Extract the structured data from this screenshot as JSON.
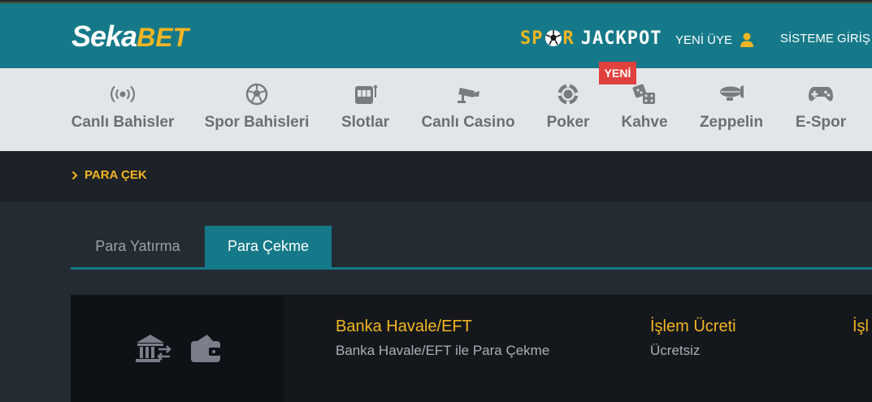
{
  "header": {
    "logo_part1": "Seka",
    "logo_part2": "BET",
    "jackpot_left": "SP",
    "jackpot_right": "R",
    "jackpot_word": "JACKPOT",
    "register_label": "YENİ ÜYE",
    "login_label": "SİSTEME GİRİŞ"
  },
  "nav": {
    "items": [
      {
        "label": "Canlı Bahisler",
        "icon": "live-broadcast-icon"
      },
      {
        "label": "Spor Bahisleri",
        "icon": "soccer-ball-icon"
      },
      {
        "label": "Slotlar",
        "icon": "slot-machine-icon"
      },
      {
        "label": "Canlı Casino",
        "icon": "camera-icon"
      },
      {
        "label": "Poker",
        "icon": "poker-chip-icon"
      },
      {
        "label": "Kahve",
        "icon": "dice-icon"
      },
      {
        "label": "Zeppelin",
        "icon": "zeppelin-icon"
      },
      {
        "label": "E-Spor",
        "icon": "gamepad-icon"
      }
    ],
    "new_badge": "YENİ"
  },
  "breadcrumb": {
    "label": "PARA ÇEK"
  },
  "tabs": {
    "deposit": "Para Yatırma",
    "withdraw": "Para Çekme"
  },
  "method": {
    "name": "Banka Havale/EFT",
    "description": "Banka Havale/EFT ile Para Çekme",
    "fee_title": "İşlem Ücreti",
    "fee_value": "Ücretsiz",
    "third_title_partial": "İşl"
  },
  "colors": {
    "header_bg": "#157989",
    "accent_yellow": "#f2b523",
    "nav_bg": "#e3e6e9",
    "badge_red": "#e0413d",
    "page_bg": "#252b32"
  }
}
